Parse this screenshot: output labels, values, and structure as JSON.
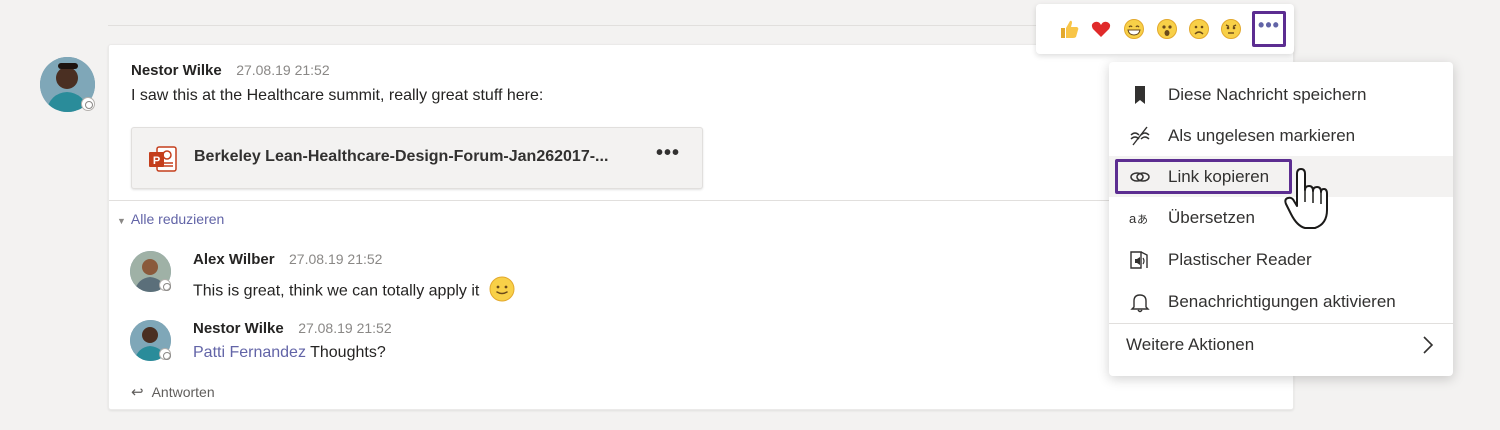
{
  "thread": {
    "root": {
      "author": "Nestor Wilke",
      "time": "27.08.19 21:52",
      "text": "I saw this at the Healthcare summit, really great stuff here:",
      "attachment": {
        "icon": "powerpoint-icon",
        "name": "Berkeley Lean-Healthcare-Design-Forum-Jan262017-...",
        "more": "•••"
      }
    },
    "collapse_label": "Alle reduzieren",
    "replies": [
      {
        "author": "Alex Wilber",
        "time": "27.08.19 21:52",
        "text": "This is great, think we can totally apply it",
        "emoji": "slightly-smiling-icon"
      },
      {
        "author": "Nestor Wilke",
        "time": "27.08.19 21:52",
        "mention": "Patti Fernandez",
        "text": "Thoughts?"
      }
    ],
    "reply_label": "Antworten"
  },
  "reactions": {
    "items": [
      "like-icon",
      "heart-icon",
      "laugh-icon",
      "surprised-icon",
      "sad-icon",
      "angry-icon"
    ],
    "more": "•••"
  },
  "menu": {
    "items": [
      {
        "icon": "bookmark-icon",
        "label": "Diese Nachricht speichern"
      },
      {
        "icon": "mark-unread-icon",
        "label": "Als ungelesen markieren"
      },
      {
        "icon": "link-icon",
        "label": "Link kopieren"
      },
      {
        "icon": "translate-icon",
        "label": "Übersetzen"
      },
      {
        "icon": "immersive-reader-icon",
        "label": "Plastischer Reader"
      },
      {
        "icon": "bell-icon",
        "label": "Benachrichtigungen aktivieren"
      }
    ],
    "more_actions": "Weitere Aktionen"
  },
  "colors": {
    "accent": "#6264a7",
    "highlight_border": "#5c2d91",
    "background": "#f3f2f1"
  }
}
